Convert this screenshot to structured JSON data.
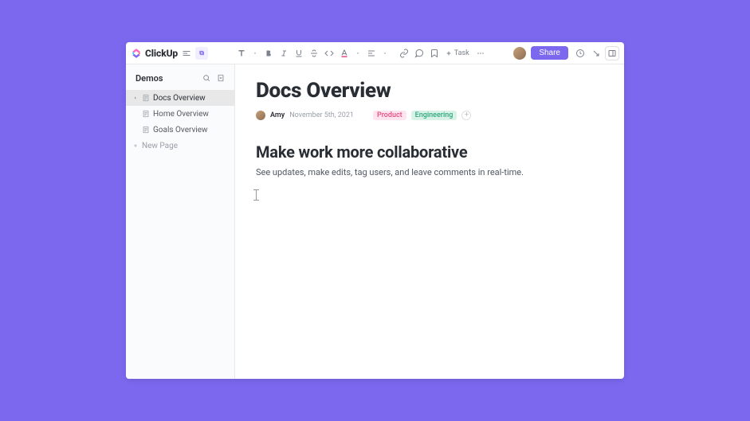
{
  "brand": {
    "name": "ClickUp"
  },
  "toolbar": {
    "task_label": "Task",
    "share_label": "Share"
  },
  "sidebar": {
    "title": "Demos",
    "items": [
      {
        "label": "Docs Overview",
        "active": true,
        "expandable": true,
        "icon": "doc"
      },
      {
        "label": "Home Overview",
        "active": false,
        "expandable": false,
        "icon": "doc"
      },
      {
        "label": "Goals Overview",
        "active": false,
        "expandable": false,
        "icon": "doc"
      }
    ],
    "new_page_label": "New Page"
  },
  "doc": {
    "title": "Docs Overview",
    "author": "Amy",
    "date": "November 5th, 2021",
    "tags": [
      {
        "label": "Product",
        "class": "tag-product"
      },
      {
        "label": "Engineering",
        "class": "tag-eng"
      }
    ],
    "sections": [
      {
        "heading": "Make work more collaborative",
        "body": "See updates, make edits, tag users, and leave comments in real-time."
      }
    ]
  }
}
